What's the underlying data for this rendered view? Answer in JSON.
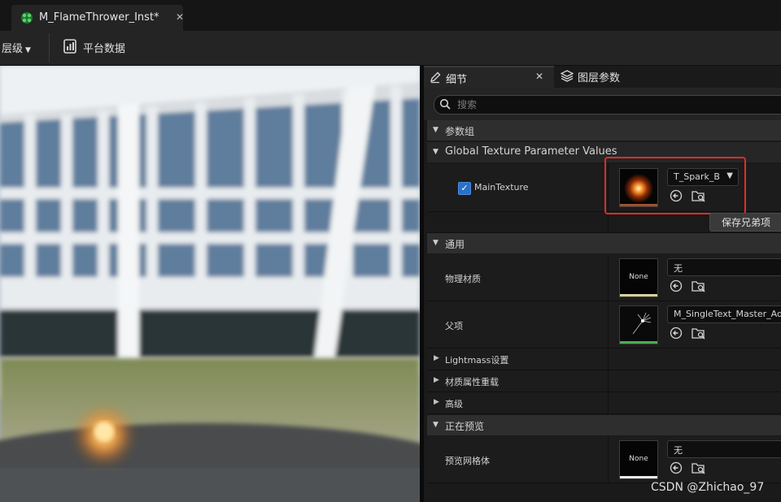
{
  "document_tab": {
    "title": "M_FlameThrower_Inst*",
    "close": "✕"
  },
  "toolbar": {
    "hierarchy_label": "层级",
    "platform_data_label": "平台数据"
  },
  "details_panel": {
    "tab_details": "细节",
    "tab_close": "✕",
    "tab_layer_params": "图层参数",
    "search": {
      "placeholder": "搜索",
      "value": ""
    },
    "groups": {
      "param_groups": "参数组",
      "global_texture": "Global Texture Parameter Values",
      "general": "通用",
      "lightmass": "Lightmass设置",
      "material_override": "材质属性重载",
      "advanced": "高级",
      "previewing": "正在预览"
    },
    "main_texture": {
      "label": "MainTexture",
      "checked": true,
      "asset": "T_Spark_B"
    },
    "save_sibling_button": "保存兄弟项",
    "phys_material": {
      "label": "物理材质",
      "thumb": "None",
      "asset": "无"
    },
    "parent": {
      "label": "父项",
      "asset": "M_SingleText_Master_Add"
    },
    "preview_mesh": {
      "label": "预览网格体",
      "thumb": "None",
      "asset": "无"
    }
  },
  "watermark": "CSDN @Zhichao_97",
  "colors": {
    "highlight_box": "#e22b2b",
    "checkbox": "#2a70c8"
  }
}
